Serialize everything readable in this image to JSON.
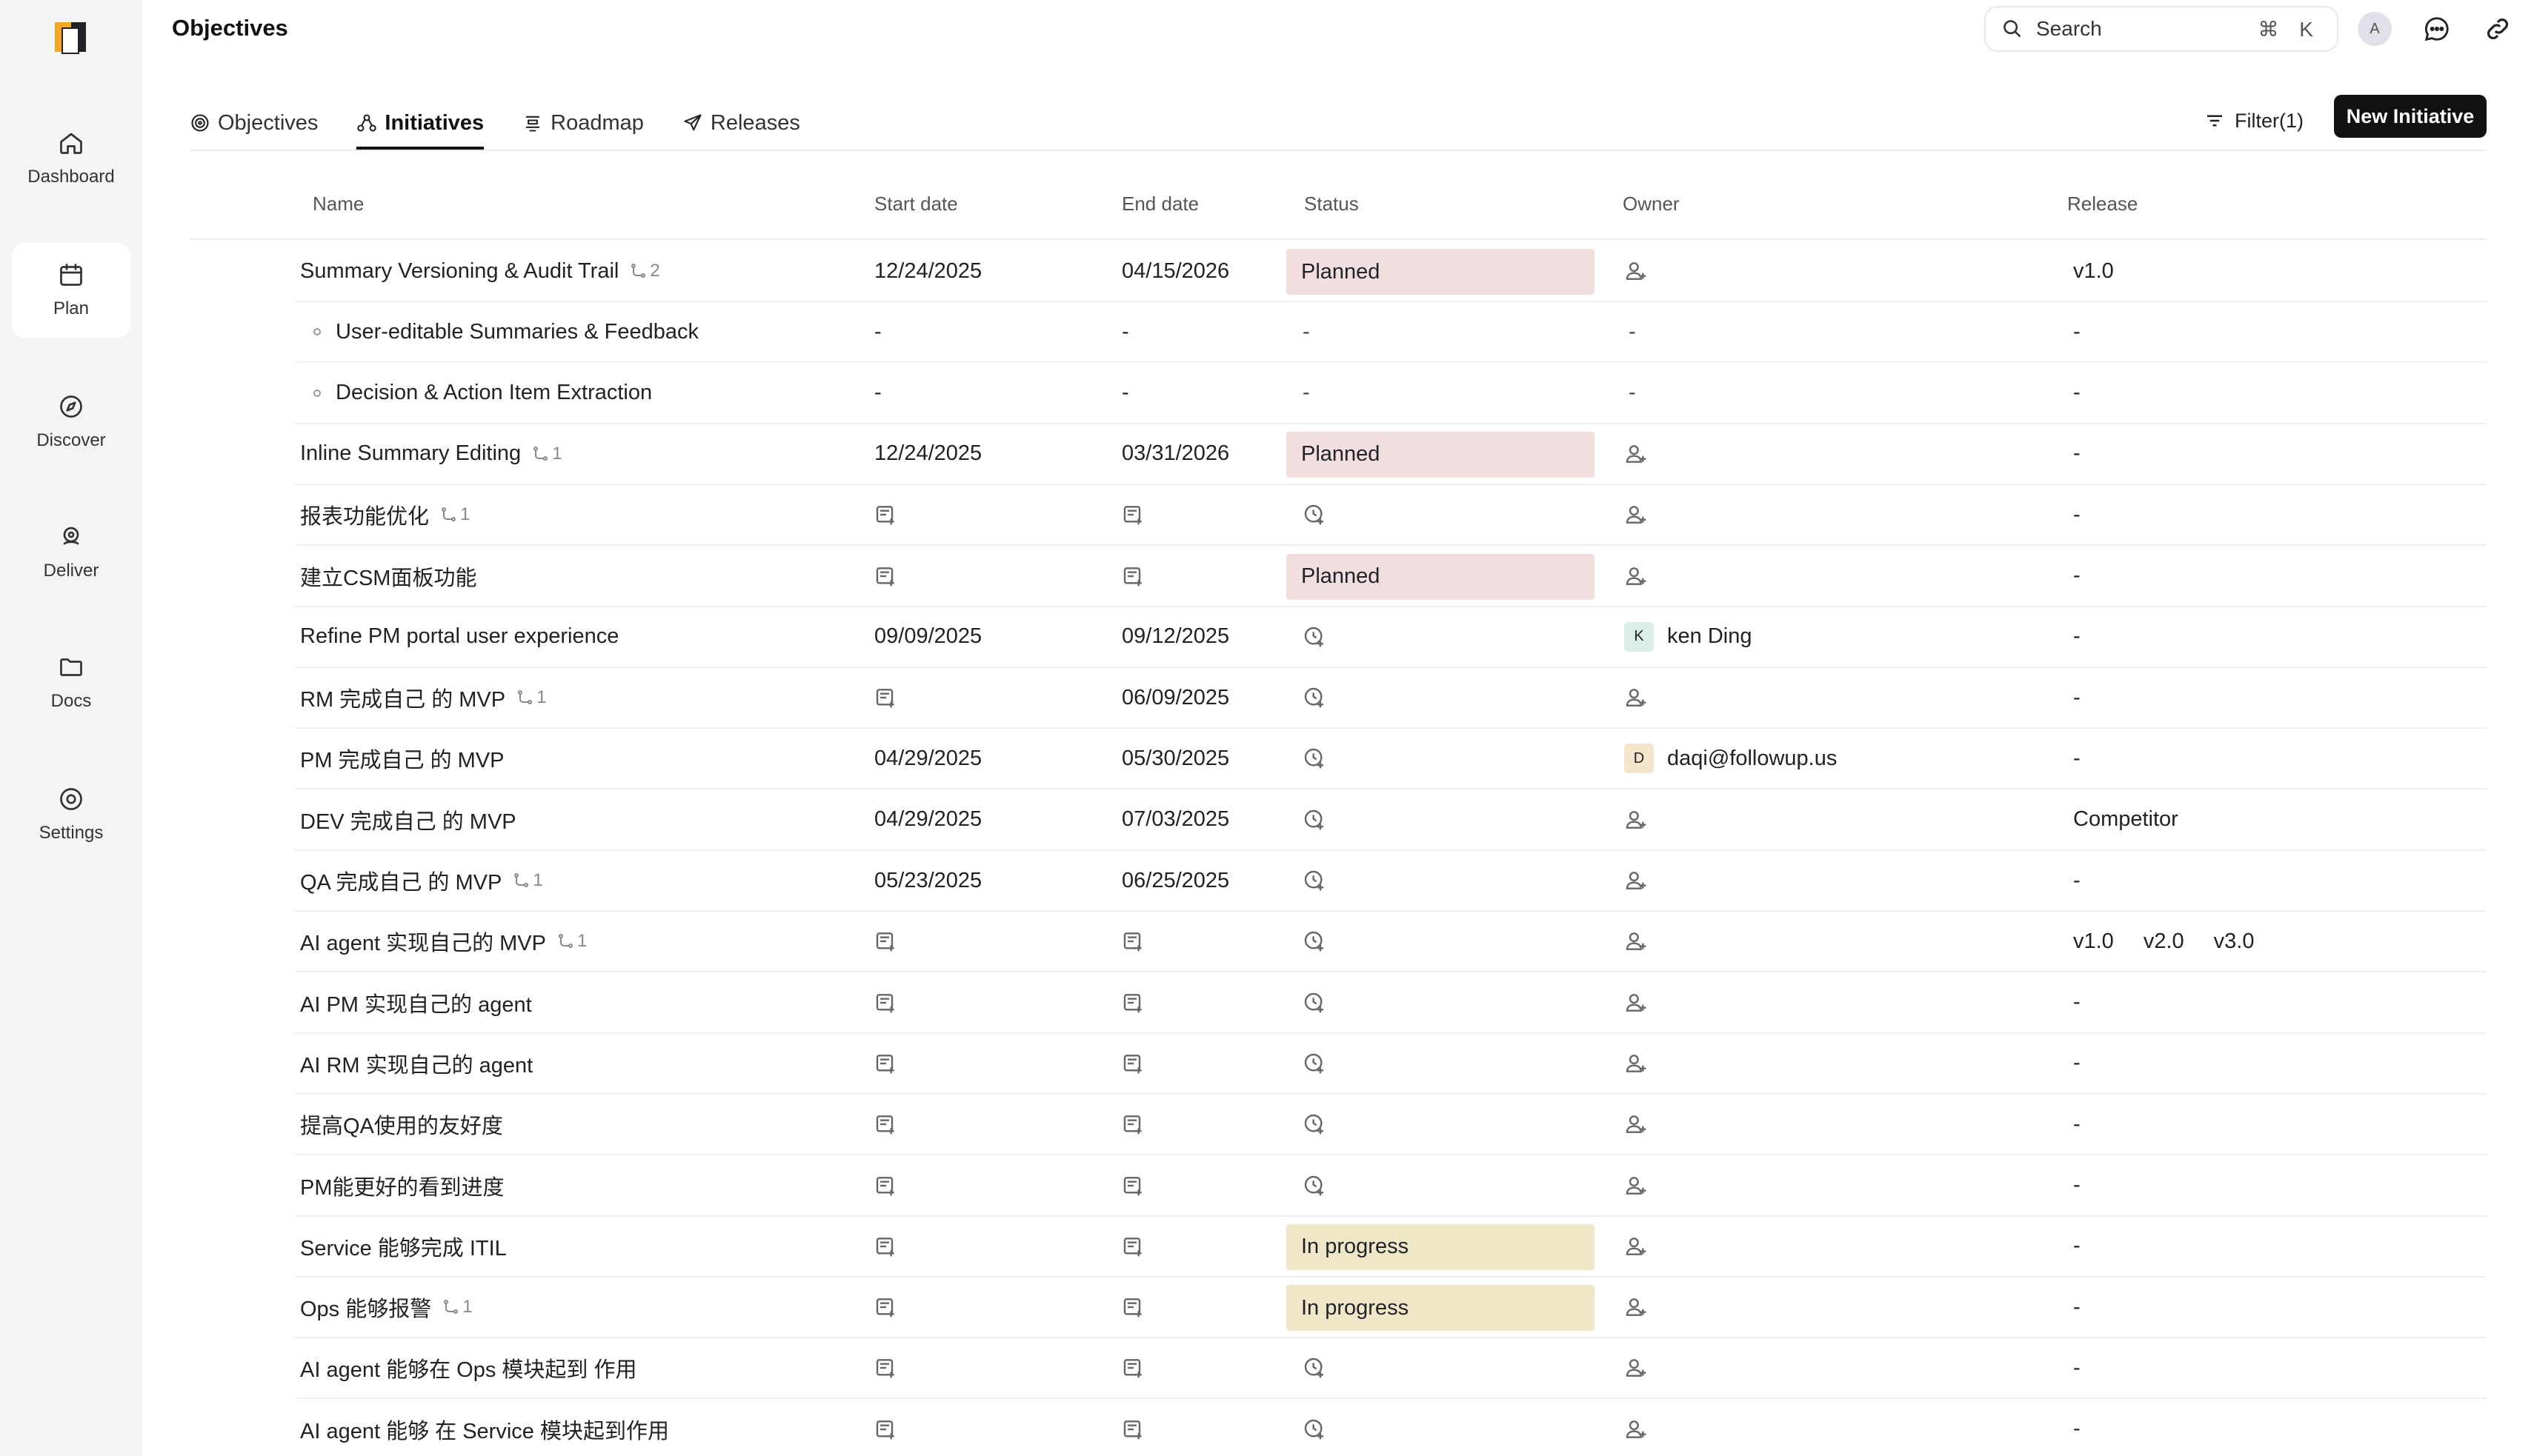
{
  "app": {
    "page_title": "Objectives"
  },
  "sidebar": {
    "items": [
      {
        "label": "Dashboard",
        "icon": "home-icon",
        "active": false
      },
      {
        "label": "Plan",
        "icon": "calendar-icon",
        "active": true
      },
      {
        "label": "Discover",
        "icon": "compass-icon",
        "active": false
      },
      {
        "label": "Deliver",
        "icon": "rocket-icon",
        "active": false
      },
      {
        "label": "Docs",
        "icon": "folder-icon",
        "active": false
      },
      {
        "label": "Settings",
        "icon": "gear-icon",
        "active": false
      }
    ]
  },
  "topbar": {
    "search_placeholder": "Search",
    "shortcut": "⌘ K",
    "avatar_initial": "A"
  },
  "tabs": [
    {
      "label": "Objectives",
      "icon": "target-icon",
      "active": false
    },
    {
      "label": "Initiatives",
      "icon": "hierarchy-icon",
      "active": true
    },
    {
      "label": "Roadmap",
      "icon": "roadmap-icon",
      "active": false
    },
    {
      "label": "Releases",
      "icon": "send-icon",
      "active": false
    }
  ],
  "toolbar": {
    "filter_label": "Filter(1)",
    "new_button": "New Initiative"
  },
  "table": {
    "columns": [
      "Name",
      "Start date",
      "End date",
      "Status",
      "Owner",
      "Release"
    ],
    "status_colors": {
      "Planned": "#f1dede",
      "In progress": "#f0e6c8"
    },
    "rows": [
      {
        "name": "Summary Versioning & Audit Trail",
        "sub": "2",
        "child": false,
        "start": "12/24/2025",
        "end": "04/15/2026",
        "status": "Planned",
        "owner": null,
        "owner_initial": null,
        "release": [
          "v1.0"
        ]
      },
      {
        "name": "User-editable Summaries & Feedback",
        "sub": null,
        "child": true,
        "start": "-",
        "end": "-",
        "status": "-",
        "owner": "-",
        "owner_initial": null,
        "release": [
          "-"
        ]
      },
      {
        "name": "Decision & Action Item Extraction",
        "sub": null,
        "child": true,
        "start": "-",
        "end": "-",
        "status": "-",
        "owner": "-",
        "owner_initial": null,
        "release": [
          "-"
        ]
      },
      {
        "name": "Inline Summary Editing",
        "sub": "1",
        "child": false,
        "start": "12/24/2025",
        "end": "03/31/2026",
        "status": "Planned",
        "owner": null,
        "owner_initial": null,
        "release": [
          "-"
        ]
      },
      {
        "name": "报表功能优化",
        "sub": "1",
        "child": false,
        "start": null,
        "end": null,
        "status": null,
        "owner": null,
        "owner_initial": null,
        "release": [
          "-"
        ]
      },
      {
        "name": "建立CSM面板功能",
        "sub": null,
        "child": false,
        "start": null,
        "end": null,
        "status": "Planned",
        "owner": null,
        "owner_initial": null,
        "release": [
          "-"
        ]
      },
      {
        "name": "Refine PM portal user experience",
        "sub": null,
        "child": false,
        "start": "09/09/2025",
        "end": "09/12/2025",
        "status": null,
        "owner": "ken Ding",
        "owner_initial": "K",
        "release": [
          "-"
        ]
      },
      {
        "name": "RM 完成自己 的 MVP",
        "sub": "1",
        "child": false,
        "start": null,
        "end": "06/09/2025",
        "status": null,
        "owner": null,
        "owner_initial": null,
        "release": [
          "-"
        ]
      },
      {
        "name": "PM 完成自己 的 MVP",
        "sub": null,
        "child": false,
        "start": "04/29/2025",
        "end": "05/30/2025",
        "status": null,
        "owner": "daqi@followup.us",
        "owner_initial": "D",
        "release": [
          "-"
        ]
      },
      {
        "name": "DEV 完成自己 的 MVP",
        "sub": null,
        "child": false,
        "start": "04/29/2025",
        "end": "07/03/2025",
        "status": null,
        "owner": null,
        "owner_initial": null,
        "release": [
          "Competitor"
        ]
      },
      {
        "name": "QA 完成自己  的 MVP",
        "sub": "1",
        "child": false,
        "start": "05/23/2025",
        "end": "06/25/2025",
        "status": null,
        "owner": null,
        "owner_initial": null,
        "release": [
          "-"
        ]
      },
      {
        "name": "AI agent 实现自己的 MVP",
        "sub": "1",
        "child": false,
        "start": null,
        "end": null,
        "status": null,
        "owner": null,
        "owner_initial": null,
        "release": [
          "v1.0",
          "v2.0",
          "v3.0"
        ]
      },
      {
        "name": "AI PM 实现自己的 agent",
        "sub": null,
        "child": false,
        "start": null,
        "end": null,
        "status": null,
        "owner": null,
        "owner_initial": null,
        "release": [
          "-"
        ]
      },
      {
        "name": "AI RM 实现自己的 agent",
        "sub": null,
        "child": false,
        "start": null,
        "end": null,
        "status": null,
        "owner": null,
        "owner_initial": null,
        "release": [
          "-"
        ]
      },
      {
        "name": "提高QA使用的友好度",
        "sub": null,
        "child": false,
        "start": null,
        "end": null,
        "status": null,
        "owner": null,
        "owner_initial": null,
        "release": [
          "-"
        ]
      },
      {
        "name": "PM能更好的看到进度",
        "sub": null,
        "child": false,
        "start": null,
        "end": null,
        "status": null,
        "owner": null,
        "owner_initial": null,
        "release": [
          "-"
        ]
      },
      {
        "name": "Service 能够完成 ITIL",
        "sub": null,
        "child": false,
        "start": null,
        "end": null,
        "status": "In progress",
        "owner": null,
        "owner_initial": null,
        "release": [
          "-"
        ]
      },
      {
        "name": "Ops 能够报警",
        "sub": "1",
        "child": false,
        "start": null,
        "end": null,
        "status": "In progress",
        "owner": null,
        "owner_initial": null,
        "release": [
          "-"
        ]
      },
      {
        "name": "AI agent 能够在 Ops 模块起到 作用",
        "sub": null,
        "child": false,
        "start": null,
        "end": null,
        "status": null,
        "owner": null,
        "owner_initial": null,
        "release": [
          "-"
        ]
      },
      {
        "name": "AI agent 能够 在 Service  模块起到作用",
        "sub": null,
        "child": false,
        "start": null,
        "end": null,
        "status": null,
        "owner": null,
        "owner_initial": null,
        "release": [
          "-"
        ]
      }
    ]
  }
}
